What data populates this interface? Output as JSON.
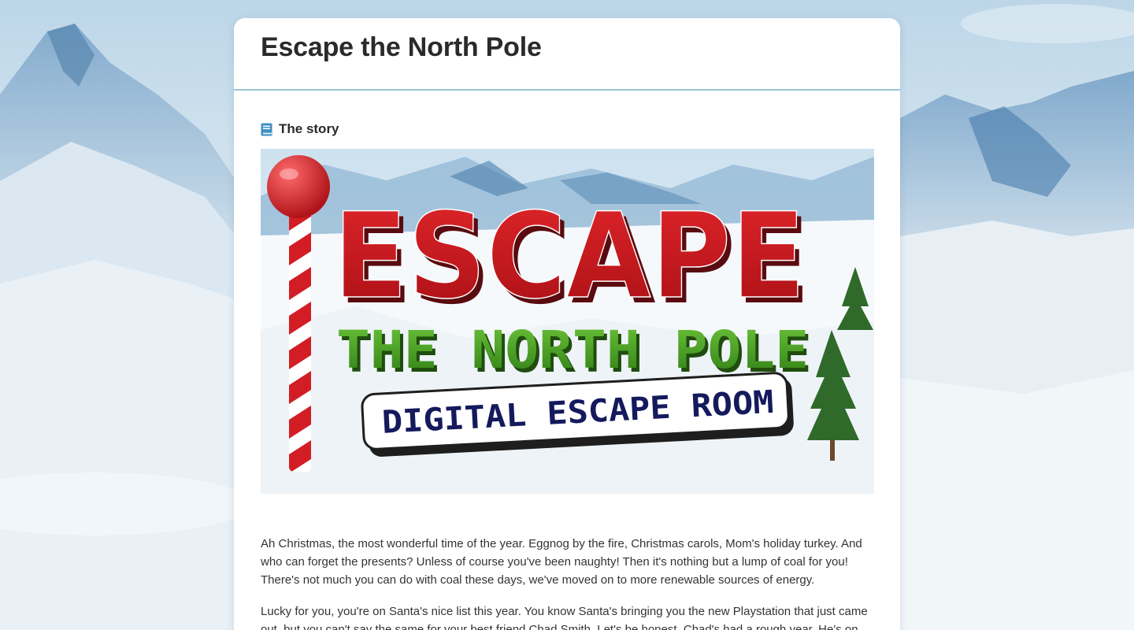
{
  "header": {
    "title": "Escape the North Pole"
  },
  "section": {
    "icon": "book-icon",
    "label": "The story"
  },
  "banner": {
    "line1": "ESCAPE",
    "line2": "THE NORTH POLE",
    "line3": "DIGITAL ESCAPE ROOM"
  },
  "story": {
    "paragraphs": [
      "Ah Christmas, the most wonderful time of the year. Eggnog by the fire, Christmas carols, Mom's holiday turkey. And who can forget the presents? Unless of course you've been naughty! Then it's nothing but a lump of coal for you! There's not much you can do with coal these days, we've moved on to more renewable sources of energy.",
      "Lucky for you, you're on Santa's nice list this year. You know Santa's bringing you the new Playstation that just came out, but you can't say the same for your best friend Chad Smith. Let's be honest, Chad's had a rough year. He's on"
    ]
  },
  "colors": {
    "accent_border": "#9cc3d9",
    "title_red": "#c8161d",
    "title_green": "#3f9a1e",
    "room_navy": "#141a5c"
  }
}
